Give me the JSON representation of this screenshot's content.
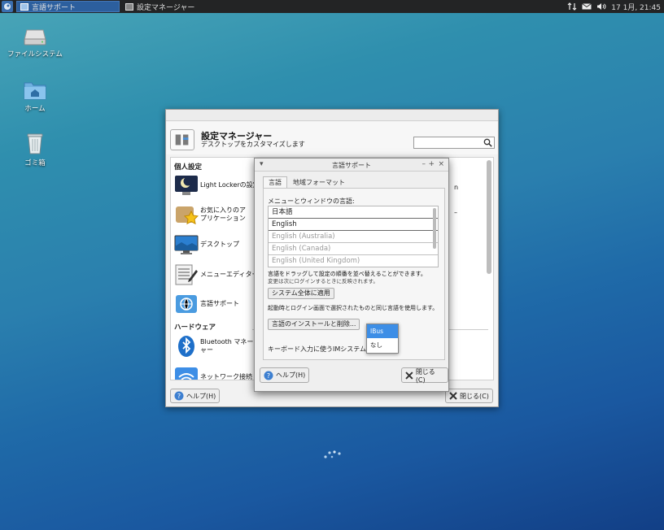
{
  "panel": {
    "tasks": [
      {
        "label": "言語サポート",
        "active": true
      },
      {
        "label": "設定マネージャー",
        "active": false
      }
    ],
    "clock": "17 1月, 21:45"
  },
  "desktop": {
    "icons": [
      {
        "label": "ファイルシステム",
        "icon": "drive-icon"
      },
      {
        "label": "ホーム",
        "icon": "home-folder-icon"
      },
      {
        "label": "ゴミ箱",
        "icon": "trash-icon"
      }
    ]
  },
  "settings_manager": {
    "title": "設定マネージャー",
    "subtitle": "デスクトップをカスタマイズします",
    "search_placeholder": "",
    "categories": {
      "personal": "個人設定",
      "hardware": "ハードウェア"
    },
    "items": [
      {
        "label": "Light Lockerの設定",
        "icon": "moon-icon"
      },
      {
        "label": "お気に入りのアプリケーション",
        "icon": "favorite-star-icon"
      },
      {
        "label": "デスクトップ",
        "icon": "desktop-icon"
      },
      {
        "label": "メニューエディター",
        "icon": "menu-editor-icon"
      },
      {
        "label": "言語サポート",
        "icon": "language-icon"
      },
      {
        "label": "Bluetooth マネージャー",
        "icon": "bluetooth-icon"
      },
      {
        "label": "ネットワーク接続",
        "icon": "wifi-icon"
      }
    ],
    "right_fragments": {
      "n": "n",
      "dash": "–"
    },
    "help_label": "ヘルプ(H)",
    "close_label": "閉じる(C)"
  },
  "language_support": {
    "title": "言語サポート",
    "tabs": [
      "言語",
      "地域フォーマット"
    ],
    "menu_language_label": "メニューとウィンドウの言語:",
    "languages": [
      {
        "name": "日本語",
        "dim": false
      },
      {
        "name": "English",
        "dim": false
      },
      {
        "name": "English (Australia)",
        "dim": true
      },
      {
        "name": "English (Canada)",
        "dim": true
      },
      {
        "name": "English (United Kingdom)",
        "dim": true
      }
    ],
    "drag_note": "言語をドラッグして設定の順番を並べ替えることができます。",
    "login_note": "変更は次にログインするときに反映されます。",
    "apply_system_wide": "システム全体に適用",
    "apply_note": "起動時とログイン画面で選択されたものと同じ言語を使用します。",
    "install_remove": "言語のインストールと削除...",
    "im_label": "キーボード入力に使うIMシステム:",
    "im_options": [
      "IBus",
      "なし"
    ],
    "im_selected": "IBus",
    "help_label": "ヘルプ(H)",
    "close_label": "閉じる(C)"
  },
  "colors": {
    "accent": "#3d8ee6",
    "panel": "#232425",
    "active_task": "#2c5f9e"
  }
}
